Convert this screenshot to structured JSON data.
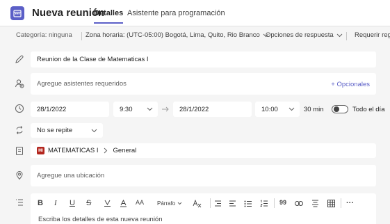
{
  "header": {
    "title": "Nueva reunión",
    "tabs": [
      {
        "label": "Detalles",
        "active": true
      },
      {
        "label": "Asistente para programación",
        "active": false
      }
    ]
  },
  "toolbar": {
    "category": "Categoría: ninguna",
    "timezone": "Zona horaria: (UTC-05:00) Bogotá, Lima, Quito, Rio Branco",
    "response_options": "Opciones de respuesta",
    "require": "Requerir regi"
  },
  "form": {
    "title_value": "Reunion de la Clase de Matematicas I",
    "attendees_placeholder": "Agregue asistentes requeridos",
    "optional_link": "+ Opcionales",
    "start_date": "28/1/2022",
    "start_time": "9:30",
    "end_date": "28/1/2022",
    "end_time": "10:00",
    "duration": "30 min",
    "all_day_label": "Todo el día",
    "all_day": false,
    "repeat": "No se repite",
    "channel_badge": "MI",
    "team": "MATEMATICAS I",
    "channel": "General",
    "location_placeholder": "Agregue una ubicación",
    "details_placeholder": "Escriba los detalles de esta nueva reunión"
  },
  "editor_toolbar": {
    "bold": "B",
    "italic": "I",
    "underline": "U",
    "strike": "S",
    "font_size": "AA",
    "paragraph": "Párrafo",
    "quote": "99",
    "more": "···"
  },
  "colors": {
    "accent": "#5b5fc7",
    "channel_badge": "#b3261e",
    "background": "#f5f5f5"
  },
  "icons": {
    "app": "calendar-icon",
    "title_row": "pencil-icon",
    "attendees_row": "person-add-icon",
    "time_row": "clock-icon",
    "repeat_row": "repeat-icon",
    "channel_row": "channel-icon",
    "location_row": "location-pin-icon",
    "details_row": "details-list-icon"
  }
}
